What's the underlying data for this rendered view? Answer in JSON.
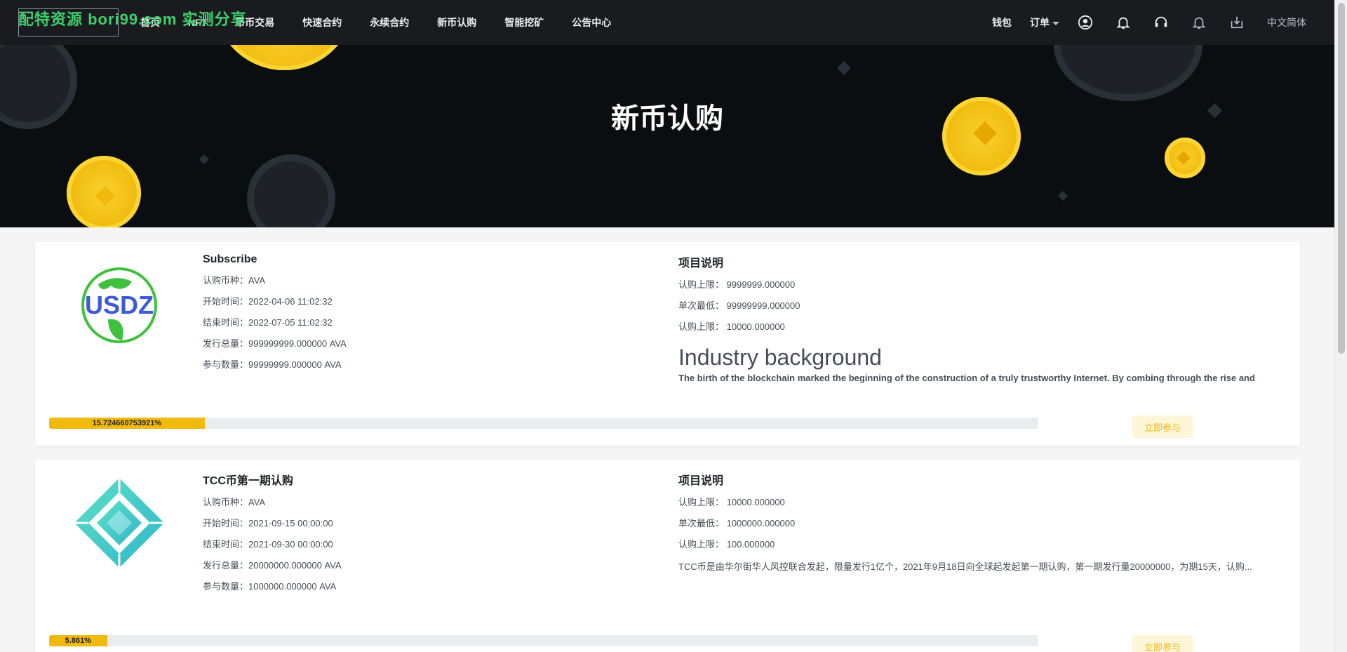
{
  "watermark": "配特资源 bori99.com 实测分享",
  "nav": {
    "links": [
      "首页",
      "NFT",
      "币币交易",
      "快速合约",
      "永续合约",
      "新币认购",
      "智能挖矿",
      "公告中心"
    ],
    "wallet": "钱包",
    "orders": "订单",
    "language": "中文简体",
    "icons": [
      "user-icon",
      "bell-icon",
      "headset-icon",
      "notification-icon",
      "download-icon"
    ]
  },
  "banner": {
    "title": "新币认购"
  },
  "cards": [
    {
      "logo": "USDZ",
      "name": "Subscribe",
      "labels": {
        "coin": "认购币种：",
        "start": "开始时间：",
        "end": "结束时间：",
        "total": "发行总量：",
        "joined": "参与数量："
      },
      "coin": "AVA",
      "start": "2022-04-06 11:02:32",
      "end": "2022-07-05 11:02:32",
      "total": "999999999.000000 AVA",
      "joined": "99999999.000000 AVA",
      "desc_title": "项目说明",
      "limit_label_1": "认购上限：",
      "limit_1": "9999999.000000",
      "min_label": "单次最低：",
      "min": "99999999.000000",
      "limit_label_2": "认购上限：",
      "limit_2": "10000.000000",
      "bg_title": "Industry background",
      "bg_text": "The birth of the blockchain marked the beginning of the construction of a truly trustworthy Internet. By combing through the rise and",
      "progress_text": "15.724660753921%",
      "progress_value": 15.724660753921,
      "button": "立即参与"
    },
    {
      "logo": "TCC",
      "name": "TCC币第一期认购",
      "labels": {
        "coin": "认购币种：",
        "start": "开始时间：",
        "end": "结束时间：",
        "total": "发行总量：",
        "joined": "参与数量："
      },
      "coin": "AVA",
      "start": "2021-09-15 00:00:00",
      "end": "2021-09-30 00:00:00",
      "total": "20000000.000000 AVA",
      "joined": "1000000.000000 AVA",
      "desc_title": "项目说明",
      "limit_label_1": "认购上限：",
      "limit_1": "10000.000000",
      "min_label": "单次最低：",
      "min": "1000000.000000",
      "limit_label_2": "认购上限：",
      "limit_2": "100.000000",
      "desc_text": "TCC币是由华尔街华人风控联合发起，限量发行1亿个，2021年9月18日向全球起发起第一期认购，第一期发行量20000000，为期15天，认购...",
      "progress_text": "5.861%",
      "progress_value": 5.861,
      "button": "立即参与"
    }
  ],
  "colors": {
    "accent": "#f0b90b",
    "nav_bg": "#1a1b1e",
    "banner_bg": "#0b0e11",
    "usdz_blue": "#3d5bd9",
    "usdz_green": "#3ec23e",
    "tcc_teal": "#4fd1c5"
  }
}
